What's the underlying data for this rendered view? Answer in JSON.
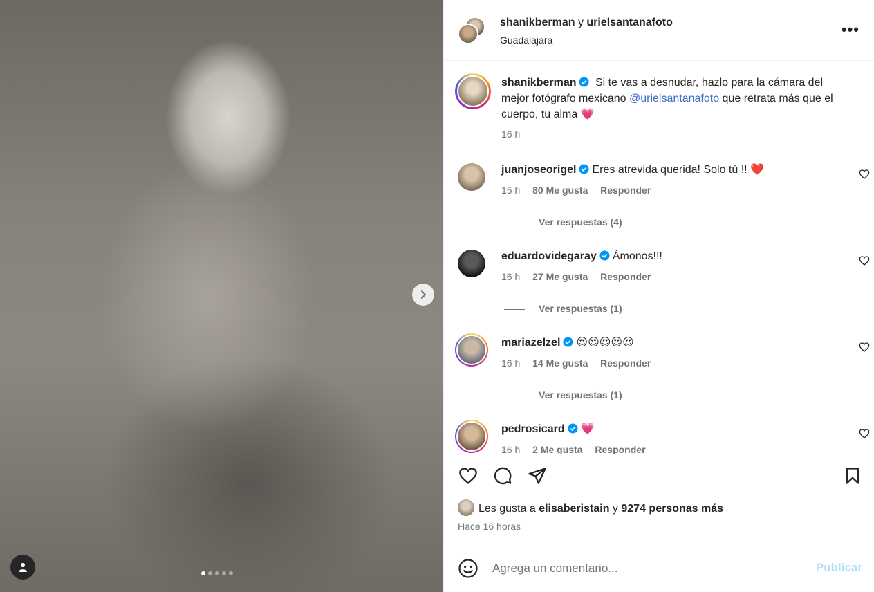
{
  "post": {
    "authors": {
      "first": "shanikberman",
      "joiner": "y",
      "second": "urielsantanafoto"
    },
    "location": "Guadalajara",
    "more_label": "•••"
  },
  "media": {
    "slide_count": 5,
    "active_slide": 1
  },
  "caption": {
    "username": "shanikberman",
    "text_before": "Si te vas a desnudar, hazlo para la cámara del mejor fotógrafo mexicano",
    "mention": "@urielsantanafoto",
    "text_after": "que retrata más que el cuerpo, tu alma",
    "emoji": "💗",
    "time": "16 h"
  },
  "comments": [
    {
      "username": "juanjoseorigel",
      "text": "Eres atrevida querida! Solo tú !!",
      "emoji": "❤️",
      "time": "15 h",
      "likes": "80 Me gusta",
      "reply": "Responder",
      "replies": "Ver respuestas (4)"
    },
    {
      "username": "eduardovidegaray",
      "text": "Ámonos!!!",
      "emoji": "",
      "time": "16 h",
      "likes": "27 Me gusta",
      "reply": "Responder",
      "replies": "Ver respuestas (1)"
    },
    {
      "username": "mariazelzel",
      "text": "",
      "emoji": "😍😍😍😍😍",
      "time": "16 h",
      "likes": "14 Me gusta",
      "reply": "Responder",
      "replies": "Ver respuestas (1)"
    },
    {
      "username": "pedrosicard",
      "text": "",
      "emoji": "💗",
      "time": "16 h",
      "likes": "2 Me gusta",
      "reply": "Responder",
      "replies": ""
    }
  ],
  "likes": {
    "prefix": "Les gusta a",
    "user": "elisaberistain",
    "joiner": "y",
    "others": "9274 personas más"
  },
  "timestamp": "Hace 16 horas",
  "add_comment": {
    "placeholder": "Agrega un comentario...",
    "publish": "Publicar"
  },
  "colors": {
    "verified": "#0095f6",
    "mention": "#3d6ec9",
    "publish_disabled": "#b2dffc",
    "secondary_text": "#737373"
  }
}
